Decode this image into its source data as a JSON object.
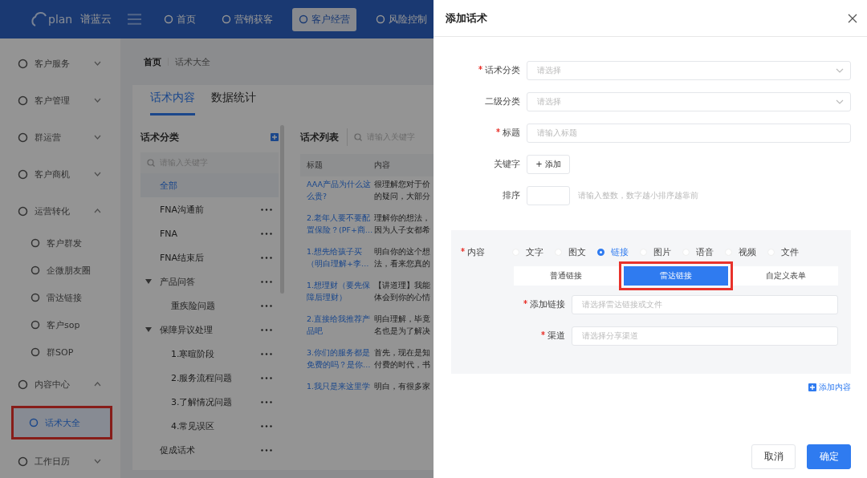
{
  "top_nav": {
    "logo_mark": "plan",
    "brand": "谱蓝云",
    "items": [
      {
        "label": "首页",
        "selected": false
      },
      {
        "label": "营销获客",
        "selected": false
      },
      {
        "label": "客户经营",
        "selected": true
      },
      {
        "label": "风险控制",
        "selected": false
      }
    ]
  },
  "sidebar": {
    "items": [
      {
        "label": "客户服务",
        "expanded": false
      },
      {
        "label": "客户管理",
        "expanded": false
      },
      {
        "label": "群运营",
        "expanded": false
      },
      {
        "label": "客户商机",
        "expanded": false
      },
      {
        "label": "运营转化",
        "expanded": true,
        "children": [
          {
            "label": "客户群发",
            "selected": false,
            "highlighted": false
          },
          {
            "label": "企微朋友圈",
            "selected": false,
            "highlighted": false
          },
          {
            "label": "雷达链接",
            "selected": false,
            "highlighted": false
          },
          {
            "label": "客户sop",
            "selected": false,
            "highlighted": false
          },
          {
            "label": "群SOP",
            "selected": false,
            "highlighted": false
          }
        ]
      },
      {
        "label": "内容中心",
        "expanded": true,
        "children": [
          {
            "label": "话术大全",
            "selected": true,
            "highlighted": true
          }
        ]
      },
      {
        "label": "工作日历",
        "expanded": false
      }
    ]
  },
  "breadcrumb": [
    "首页",
    "话术大全"
  ],
  "tabs": [
    {
      "label": "话术内容",
      "selected": true
    },
    {
      "label": "数据统计",
      "selected": false
    }
  ],
  "category_panel": {
    "title": "话术分类",
    "search": {
      "placeholder": "请输入关键字"
    },
    "tree": [
      {
        "label": "全部",
        "selected": true
      },
      {
        "label": "FNA沟通前",
        "selected": false
      },
      {
        "label": "FNA",
        "selected": false
      },
      {
        "label": "FNA结束后",
        "selected": false
      },
      {
        "label": "产品问答",
        "selected": false,
        "expanded": true,
        "children": [
          {
            "label": "重疾险问题",
            "selected": false
          }
        ]
      },
      {
        "label": "保障异议处理",
        "selected": false,
        "expanded": true,
        "children": [
          {
            "label": "1.寒暄阶段",
            "selected": false
          },
          {
            "label": "2.服务流程问题",
            "selected": false
          },
          {
            "label": "3.了解情况问题",
            "selected": false
          },
          {
            "label": "4.常见误区",
            "selected": false
          }
        ]
      },
      {
        "label": "促成话术",
        "selected": false
      }
    ]
  },
  "list_panel": {
    "title": "话术列表",
    "search": {
      "placeholder": "请输入关键字"
    },
    "columns": [
      "标题",
      "内容"
    ],
    "rows": [
      {
        "title": "AAA产品为什么这么贵?",
        "content": "很理解您对于价的疑问，大部分"
      },
      {
        "title": "2.老年人要不要配置保险？(PF+商…",
        "content": "理解你的想法，因为人子女都希"
      },
      {
        "title": "1.想先给孩子买（明白理解+李…",
        "content": "明白你的这个想法，看来您真的"
      },
      {
        "title": "1.想理财（要先保障后理财）",
        "content": "【讲道理】我能体会到你的心情"
      },
      {
        "title": "2.直接给我推荐产品吧",
        "content": "明白理解，毕竟名也是为了解决"
      },
      {
        "title": "3.你们的服务都是免费的吗？是你…",
        "content": "首先，现在是知付费的时代，书"
      },
      {
        "title": "1.我只是来这里学",
        "content": "明白，有很多家"
      }
    ]
  },
  "drawer": {
    "title": "添加话术",
    "fields": [
      {
        "kind": "select",
        "label": "话术分类",
        "required": true,
        "placeholder": "请选择"
      },
      {
        "kind": "select",
        "label": "二级分类",
        "required": false,
        "placeholder": "请选择"
      },
      {
        "kind": "input",
        "label": "标题",
        "required": true,
        "placeholder": "请输入标题"
      },
      {
        "kind": "tag",
        "label": "关键字",
        "required": false,
        "button": "+ 添加"
      },
      {
        "kind": "number",
        "label": "排序",
        "required": false,
        "hint": "请输入整数，数字越小排序越靠前"
      }
    ],
    "content": {
      "label": "内容",
      "required": true,
      "types": [
        {
          "label": "文字",
          "selected": false
        },
        {
          "label": "图文",
          "selected": false
        },
        {
          "label": "链接",
          "selected": true
        },
        {
          "label": "图片",
          "selected": false
        },
        {
          "label": "语音",
          "selected": false
        },
        {
          "label": "视频",
          "selected": false
        },
        {
          "label": "文件",
          "selected": false
        }
      ],
      "link_types": [
        {
          "label": "普通链接",
          "selected": false,
          "highlighted": false
        },
        {
          "label": "雷达链接",
          "selected": true,
          "highlighted": true
        },
        {
          "label": "自定义表单",
          "selected": false,
          "highlighted": false
        }
      ],
      "fields": [
        {
          "label": "添加链接",
          "required": true,
          "placeholder": "请选择雷达链接或文件"
        },
        {
          "label": "渠道",
          "required": true,
          "placeholder": "请选择分享渠道"
        }
      ]
    },
    "add_content": "添加内容",
    "buttons": [
      {
        "label": "取消",
        "kind": "default"
      },
      {
        "label": "确定",
        "kind": "primary"
      }
    ]
  }
}
